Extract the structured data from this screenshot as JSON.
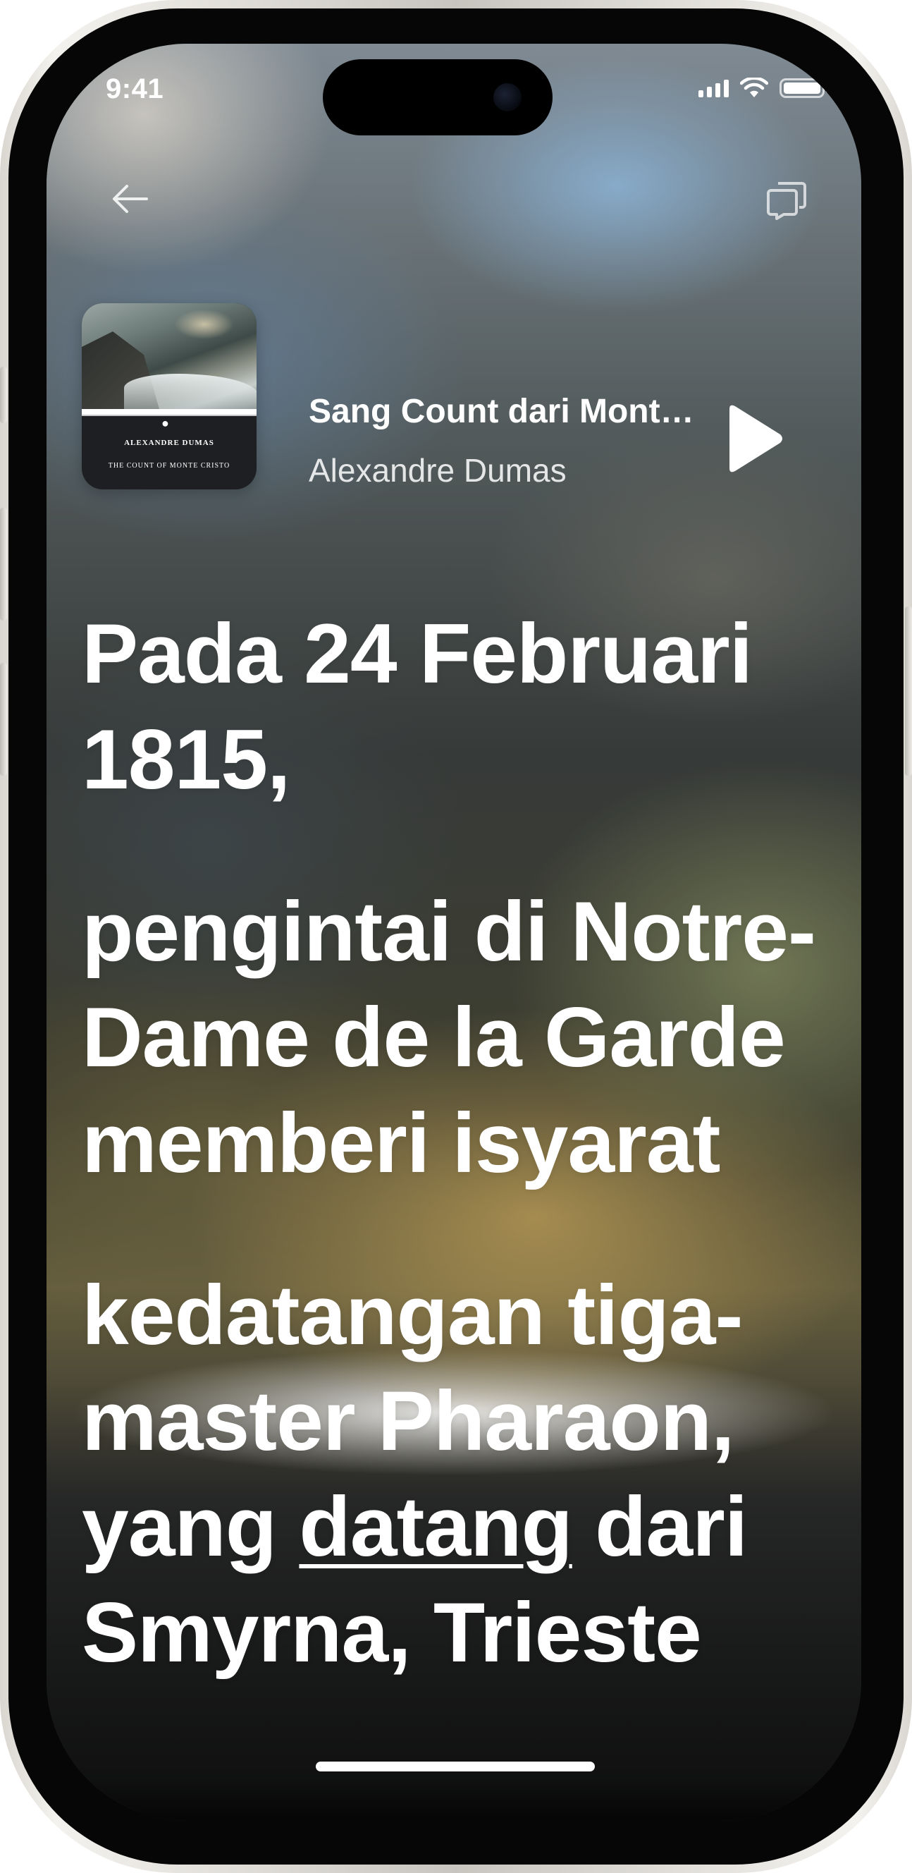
{
  "status_bar": {
    "time": "9:41"
  },
  "header": {
    "back_icon": "arrow-left-icon",
    "speech_icon": "speech-bubbles-icon"
  },
  "now_playing": {
    "title": "Sang Count dari Monte Cristo",
    "author": "Alexandre Dumas",
    "cover": {
      "author": "ALEXANDRE DUMAS",
      "title": "THE COUNT OF MONTE CRISTO"
    },
    "play_icon": "play-icon"
  },
  "reading": {
    "lines": [
      {
        "text": "Pada 24 Februari 1815,"
      },
      {
        "text": "pengintai di Notre-Dame de la Garde memberi isyarat"
      },
      {
        "text_before": "kedatangan tiga-master Pharaon,"
      },
      {
        "prefix": "yang ",
        "highlight": "datang",
        "suffix": " dari"
      },
      {
        "text": "Smyrna, Trieste"
      }
    ]
  },
  "colors": {
    "text": "#ffffff",
    "frame": "#e9e7e3"
  }
}
